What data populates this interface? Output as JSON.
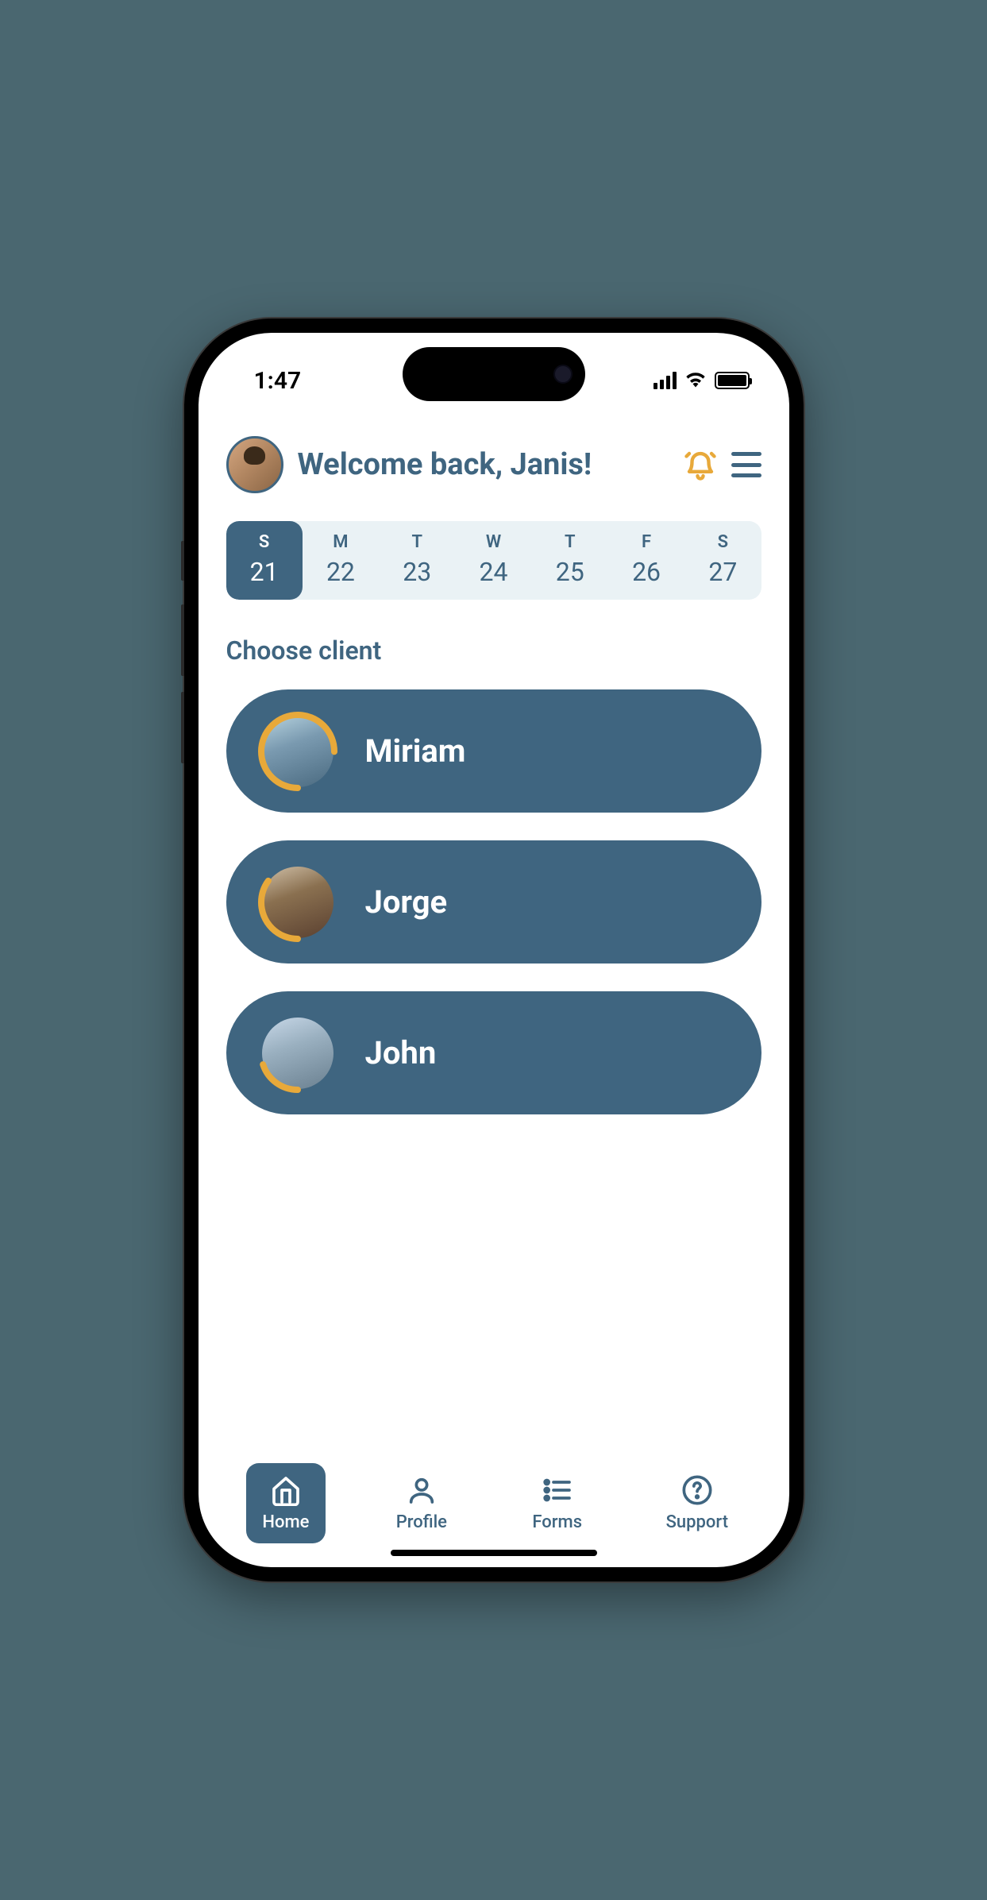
{
  "status": {
    "time": "1:47"
  },
  "header": {
    "welcome": "Welcome back, Janis!"
  },
  "week": {
    "days": [
      {
        "label": "S",
        "num": "21",
        "selected": true
      },
      {
        "label": "M",
        "num": "22",
        "selected": false
      },
      {
        "label": "T",
        "num": "23",
        "selected": false
      },
      {
        "label": "W",
        "num": "24",
        "selected": false
      },
      {
        "label": "T",
        "num": "25",
        "selected": false
      },
      {
        "label": "F",
        "num": "26",
        "selected": false
      },
      {
        "label": "S",
        "num": "27",
        "selected": false
      }
    ]
  },
  "section": {
    "choose_client": "Choose client"
  },
  "clients": [
    {
      "name": "Miriam",
      "avatar_class": "miriam",
      "progress": 0.75
    },
    {
      "name": "Jorge",
      "avatar_class": "jorge",
      "progress": 0.35
    },
    {
      "name": "John",
      "avatar_class": "john",
      "progress": 0.2
    }
  ],
  "nav": {
    "items": [
      {
        "label": "Home",
        "icon": "home-icon",
        "active": true
      },
      {
        "label": "Profile",
        "icon": "profile-icon",
        "active": false
      },
      {
        "label": "Forms",
        "icon": "forms-icon",
        "active": false
      },
      {
        "label": "Support",
        "icon": "support-icon",
        "active": false
      }
    ]
  },
  "colors": {
    "primary": "#3f6580",
    "accent": "#e8a93a",
    "week_bg": "#eaf2f5"
  }
}
